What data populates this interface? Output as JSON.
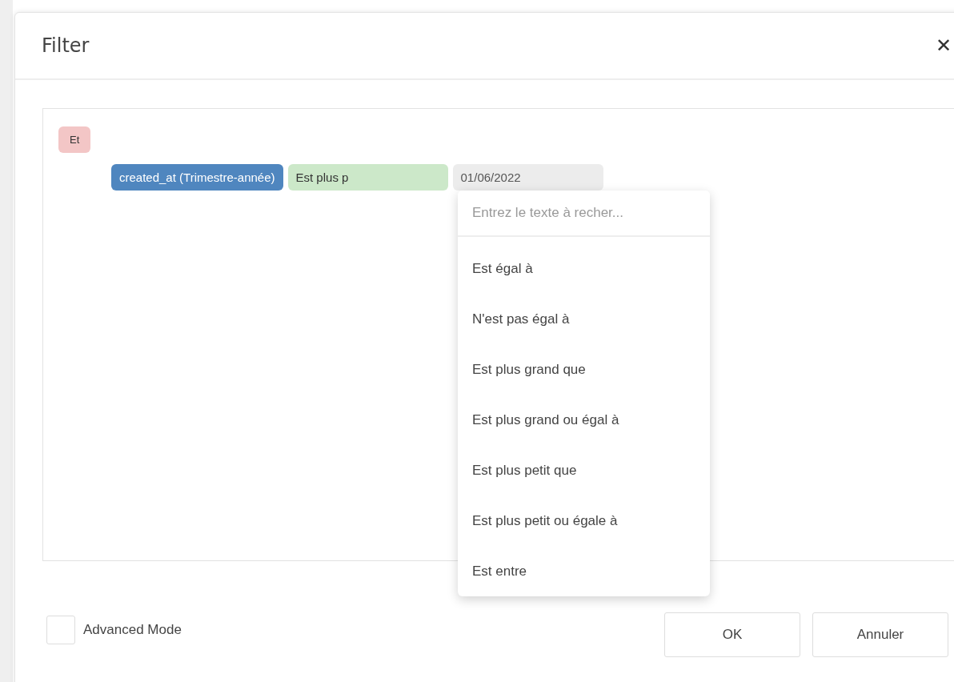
{
  "dialog": {
    "title": "Filter",
    "close": "✕"
  },
  "filter": {
    "group_operator": "Et",
    "condition": {
      "field": "created_at (Trimestre-année)",
      "operator": "Est plus p",
      "value": "01/06/2022"
    }
  },
  "dropdown": {
    "search": {
      "placeholder": "Entrez le texte à recher..."
    },
    "options": [
      {
        "label": "Est égal à"
      },
      {
        "label": "N'est pas égal à"
      },
      {
        "label": "Est plus grand que"
      },
      {
        "label": "Est plus grand ou égal à"
      },
      {
        "label": "Est plus petit que"
      },
      {
        "label": "Est plus petit ou égale à"
      },
      {
        "label": "Est entre"
      }
    ]
  },
  "advanced_mode": {
    "label": "Advanced Mode",
    "checked": false
  },
  "buttons": [
    "OK",
    "Annuler"
  ]
}
